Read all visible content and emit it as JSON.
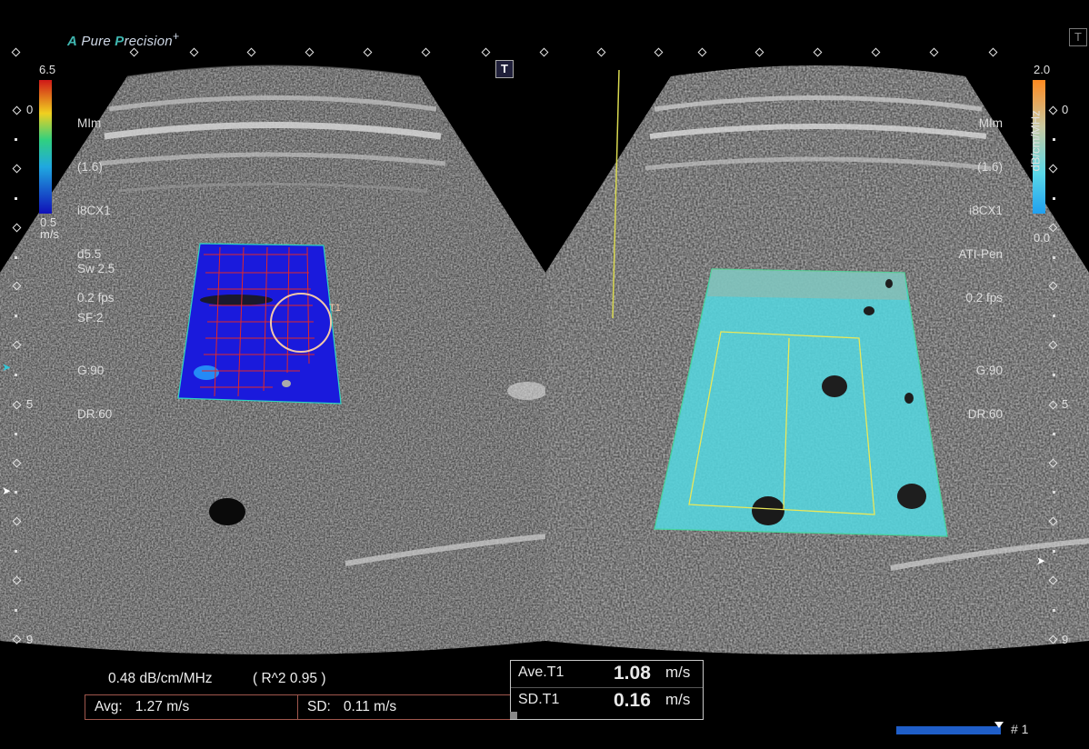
{
  "brand": {
    "prefix": "A",
    "text1": "Pure ",
    "p": "P",
    "text2": "recision",
    "plus": "+"
  },
  "t_button_left": "T",
  "t_button_right": "T",
  "left_panel": {
    "scale_max": "6.5",
    "scale_zero": "0",
    "scale_min": "0.5",
    "scale_unit": "m/s",
    "params": [
      "MIm",
      "(1.6)",
      "i8CX1",
      "d5.5",
      "0.2 fps",
      "",
      "G:90",
      "DR:60"
    ],
    "sw": "Sw 2.5",
    "sf": "SF:2",
    "roi_label": "T1"
  },
  "right_panel": {
    "scale_max": "2.0",
    "scale_zero": "0",
    "scale_min": "0.0",
    "scale_unit": "dB/cm/MHz",
    "params": [
      "MIm",
      "(1.6)",
      "i8CX1",
      "ATI-Pen",
      "0.2 fps",
      "",
      "G:90",
      "DR:60"
    ]
  },
  "depth_left": {
    "d0": "0",
    "d5": "5",
    "d9": "9"
  },
  "depth_right": {
    "d0": "0",
    "d5": "5",
    "d9": "9"
  },
  "colors": {
    "swe_blue": "#1a1adc",
    "ati_cyan": "#55d6df",
    "accent_teal": "#3fb6b0",
    "orange": "#ff9c3c"
  },
  "measurement": {
    "ati_value": "0.48 dB/cm/MHz",
    "r2": "( R^2 0.95 )",
    "avg_label": "Avg:",
    "avg_value": "1.27 m/s",
    "sd_label": "SD:",
    "sd_value": "0.11 m/s"
  },
  "results": {
    "ave_label": "Ave.T1",
    "ave_value": "1.08",
    "ave_unit": "m/s",
    "sd_label": "SD.T1",
    "sd_value": "0.16",
    "sd_unit": "m/s"
  },
  "cine": {
    "frame": "# 1",
    "progress": 0.97
  }
}
